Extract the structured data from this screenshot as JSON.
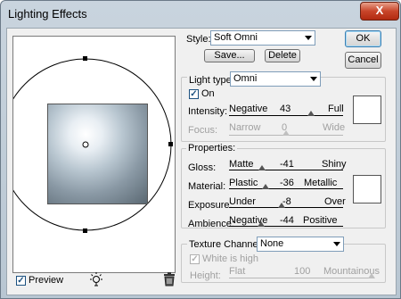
{
  "window": {
    "title": "Lighting Effects",
    "close_glyph": "X"
  },
  "preview": {
    "checkbox_label": "Preview",
    "checked": true
  },
  "style": {
    "label": "Style:",
    "value": "Soft Omni",
    "save_label": "Save...",
    "delete_label": "Delete"
  },
  "buttons": {
    "ok": "OK",
    "cancel": "Cancel"
  },
  "light": {
    "type_label": "Light type:",
    "type_value": "Omni",
    "on_label": "On",
    "on_checked": true,
    "intensity": {
      "label": "Intensity:",
      "min": "Negative",
      "value": "43",
      "max": "Full",
      "position": 0.72
    },
    "focus": {
      "label": "Focus:",
      "min": "Narrow",
      "value": "0",
      "max": "Wide",
      "position": 0.5
    },
    "color": "#ffffff"
  },
  "properties": {
    "legend": "Properties:",
    "gloss": {
      "label": "Gloss:",
      "min": "Matte",
      "value": "-41",
      "max": "Shiny",
      "position": 0.29
    },
    "material": {
      "label": "Material:",
      "min": "Plastic",
      "value": "-36",
      "max": "Metallic",
      "position": 0.32
    },
    "exposure": {
      "label": "Exposure:",
      "min": "Under",
      "value": "-8",
      "max": "Over",
      "position": 0.46
    },
    "ambience": {
      "label": "Ambience:",
      "min": "Negative",
      "value": "-44",
      "max": "Positive",
      "position": 0.28
    },
    "color": "#ffffff"
  },
  "texture": {
    "label": "Texture Channel:",
    "value": "None",
    "white_is_high": "White is high",
    "white_checked": true,
    "height": {
      "label": "Height:",
      "min": "Flat",
      "value": "100",
      "max": "Mountainous",
      "position": 1.0
    }
  },
  "icons": {
    "light_bulb": "light-bulb-icon",
    "trash": "trash-icon"
  }
}
